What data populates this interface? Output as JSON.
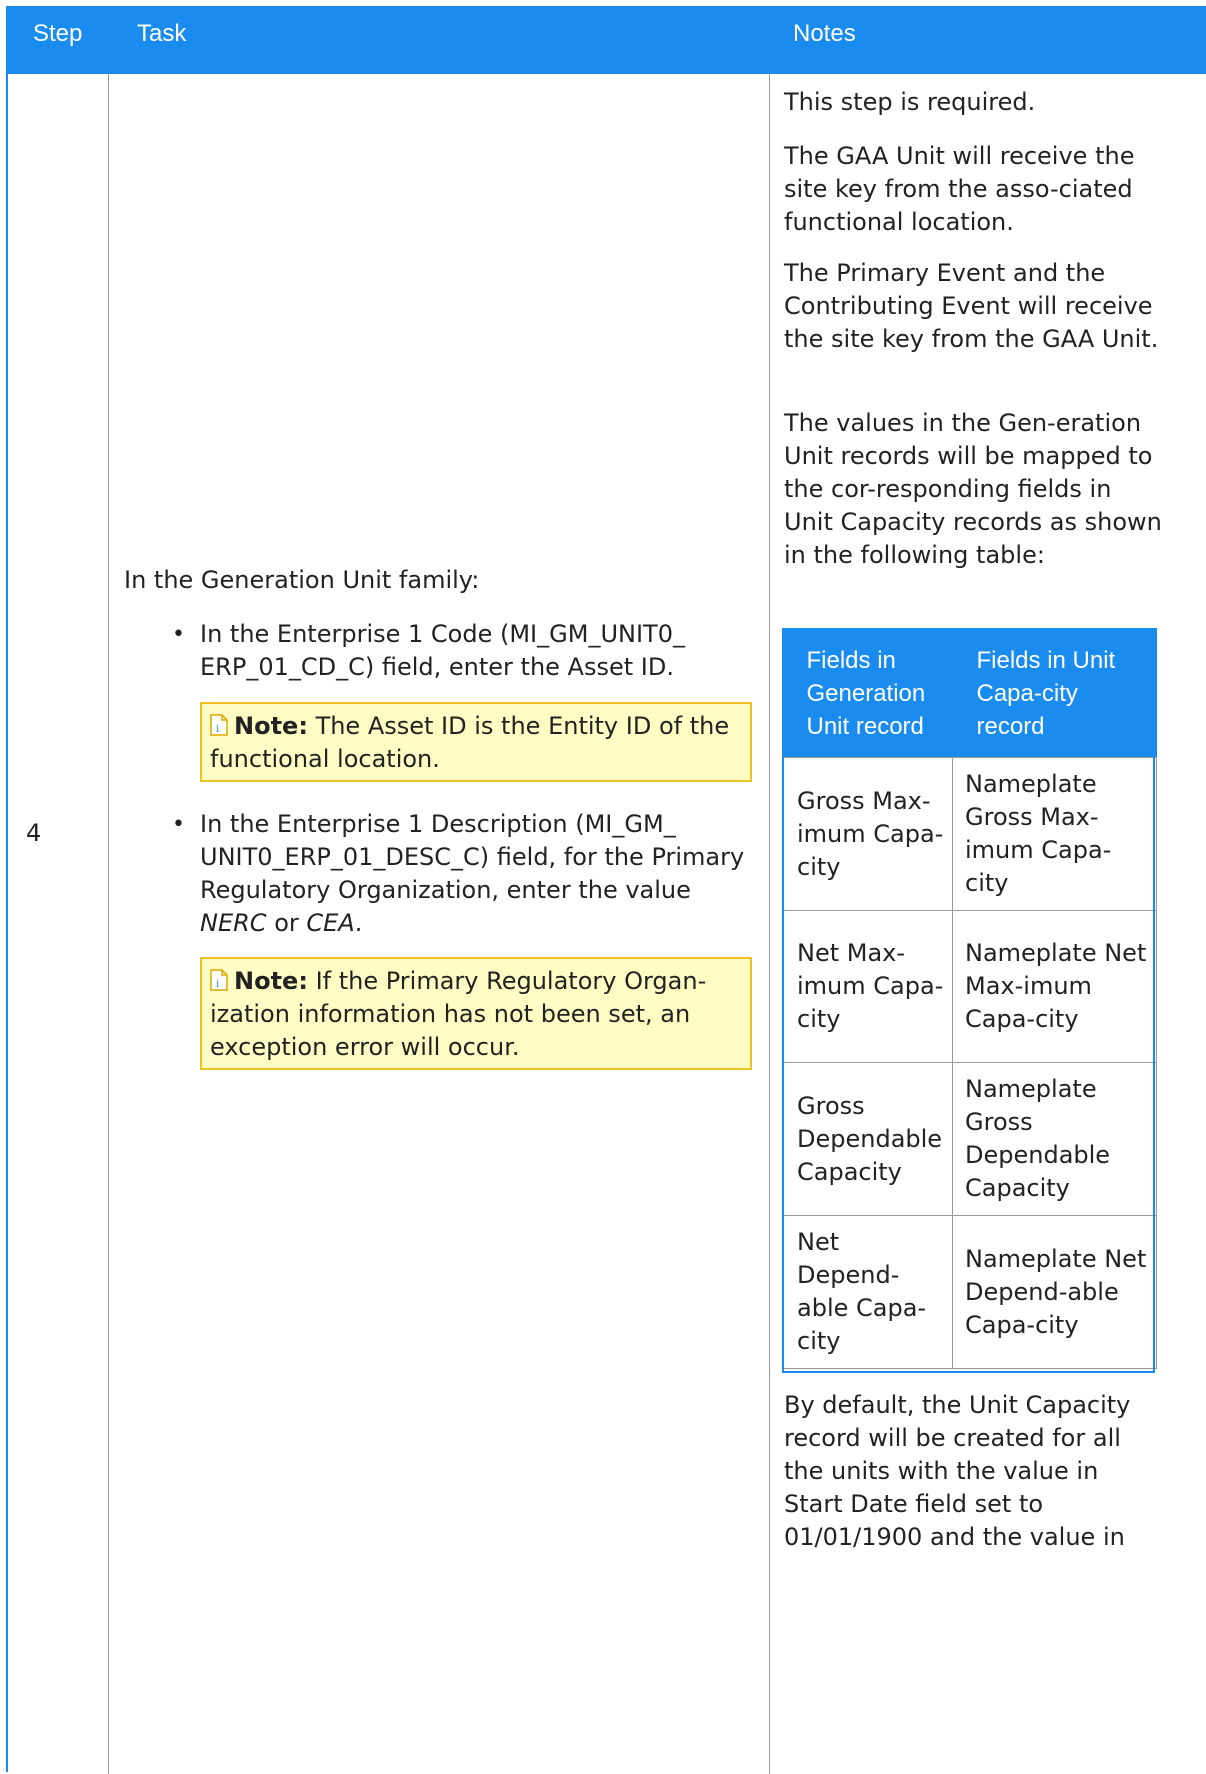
{
  "header": {
    "step": "Step",
    "task": "Task",
    "notes": "Notes"
  },
  "step_number": "4",
  "task": {
    "intro": "In the Generation Unit family:",
    "bullet1": "In the Enterprise 1 Code (MI_GM_UNIT0_ ERP_01_CD_C) field, enter the Asset ID.",
    "note1_label": "Note:",
    "note1_text": "The Asset ID is the Entity ID of the functional location.",
    "bullet2_a": "In the Enterprise 1 Description (MI_GM_ UNIT0_ERP_01_DESC_C) field, for the Primary Regulatory Organization, enter the value ",
    "bullet2_v1": "NERC",
    "bullet2_or": " or ",
    "bullet2_v2": "CEA",
    "bullet2_end": ".",
    "note2_label": "Note:",
    "note2_text": "If the Primary Regulatory Organ-ization information has not been set, an exception error will occur."
  },
  "notes": {
    "p1": "This step is required.",
    "p2": "The GAA Unit will receive the site key from the asso-ciated functional location.",
    "p3": "The Primary Event and the Contributing Event will receive the site key from the GAA Unit.",
    "p4": "The values in the Gen-eration Unit records will be mapped to the cor-responding fields in Unit Capacity records as shown in the following table:",
    "p5": "By default, the Unit Capacity record will be created for all the units with the value in Start Date field set to 01/01/1900 and the value in",
    "table": {
      "headers": [
        "Fields in Generation Unit record",
        "Fields in Unit Capa-city record"
      ],
      "rows": [
        [
          "Gross Max-imum Capa-city",
          "Nameplate Gross Max-imum Capa-city"
        ],
        [
          "Net Max-imum Capa-city",
          "Nameplate Net Max-imum Capa-city"
        ],
        [
          "Gross Dependable Capacity",
          "Nameplate Gross Dependable Capacity"
        ],
        [
          "Net Depend-able Capa-city",
          "Nameplate Net Depend-able Capa-city"
        ]
      ]
    }
  },
  "colors": {
    "header_bg": "#1a8cf0",
    "note_bg": "#fffdc4",
    "note_border": "#f0c020"
  },
  "icons": {
    "note": "note-document-icon"
  }
}
